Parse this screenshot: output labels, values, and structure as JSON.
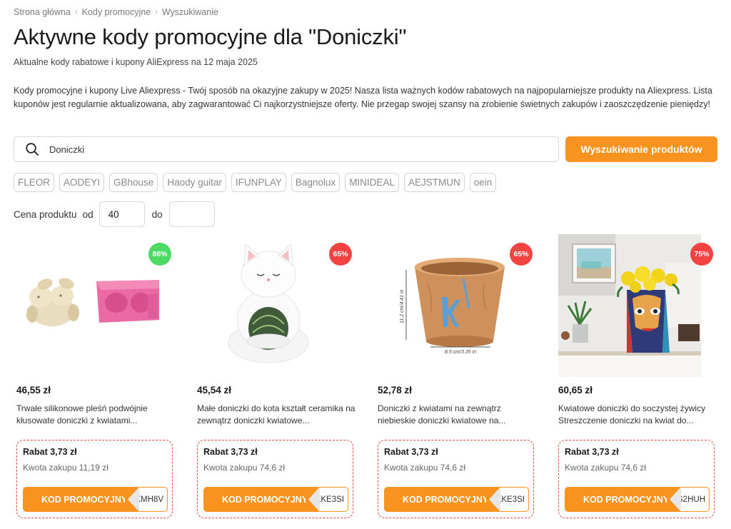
{
  "breadcrumb": [
    "Strona główna",
    "Kody promocyjne",
    "Wyszukiwanie"
  ],
  "title": "Aktywne kody promocyjne dla \"Doniczki\"",
  "subtitle": "Aktualne kody rabatowe i kupony AliExpress na 12 maja 2025",
  "intro": "Kody promocyjne i kupony Live Aliexpress - Twój sposób na okazyjne zakupy w 2025! Nasza lista ważnych kodów rabatowych na najpopularniejsze produkty na Aliexpress. Lista kuponów jest regularnie aktualizowana, aby zagwarantować Ci najkorzystniejsze oferty. Nie przegap swojej szansy na zrobienie świetnych zakupów i zaoszczędzenie pieniędzy!",
  "search": {
    "value": "Doniczki",
    "icon": "search-icon",
    "button_label": "Wyszukiwanie produktów"
  },
  "brands": [
    "FLEOR",
    "AODEYI",
    "GBhouse",
    "Haody guitar",
    "IFUNPLAY",
    "Bagnolux",
    "MINIDEAL",
    "AEJSTMUN",
    "oein"
  ],
  "price_filter": {
    "label": "Cena produktu",
    "from_label": "od",
    "from_value": "40",
    "to_label": "do",
    "to_value": ""
  },
  "colors": {
    "accent": "#f7931e",
    "discount_green": "#4cd964",
    "discount_red": "#f24343",
    "coupon_border": "#e04848"
  },
  "products": [
    {
      "discount": "86%",
      "discount_color": "#4cd964",
      "price": "46,55 zł",
      "name": "Trwałe silikonowe pleśń podwójnie kłusowate doniczki z kwiatami...",
      "rabat": "Rabat 3,73 zł",
      "kwota": "Kwota zakupu 11,19 zł",
      "code_label": "KOD PROMOCYJNY",
      "code": "KMH8V"
    },
    {
      "discount": "65%",
      "discount_color": "#f24343",
      "price": "45,54 zł",
      "name": "Małe doniczki do kota kształt ceramika na zewnątrz doniczki kwiatowe...",
      "rabat": "Rabat 3,73 zł",
      "kwota": "Kwota zakupu 74,6 zł",
      "code_label": "KOD PROMOCYJNY",
      "code": "KKE3SI"
    },
    {
      "discount": "65%",
      "discount_color": "#f24343",
      "price": "52,78 zł",
      "name": "Doniczki z kwiatami na zewnątrz niebieskie doniczki kwiatowe na...",
      "rabat": "Rabat 3,73 zł",
      "kwota": "Kwota zakupu 74,6 zł",
      "code_label": "KOD PROMOCYJNY",
      "code": "KKE3SI",
      "image_labels": [
        "11.2 cm/4.41 in",
        "8.5 cm/3.35 in"
      ]
    },
    {
      "discount": "75%",
      "discount_color": "#f24343",
      "price": "60,65 zł",
      "name": "Kwiatowe doniczki do soczystej żywicy Streszczenie doniczki na kwiat do...",
      "rabat": "Rabat 3,73 zł",
      "kwota": "Kwota zakupu 74,6 zł",
      "code_label": "KOD PROMOCYJNY",
      "code": "S2HUH"
    }
  ]
}
